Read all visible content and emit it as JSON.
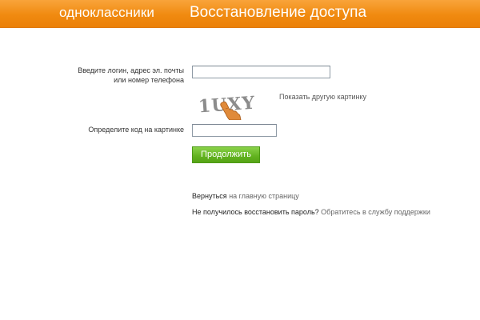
{
  "header": {
    "brand": "одноклассники",
    "title": "Восстановление доступа"
  },
  "form": {
    "login_label_line1": "Введите логин, адрес эл. почты",
    "login_label_line2": "или номер телефона",
    "login_value": "",
    "captcha_text": "1UXY",
    "refresh_captcha_link": "Показать другую картинку",
    "code_label": "Определите код на картинке",
    "code_value": "",
    "continue_button": "Продолжить"
  },
  "footer": {
    "back_prefix": "Вернуться",
    "back_link": "на главную страницу",
    "fail_text": "Не получилось восстановить пароль?",
    "support_link": "Обратитесь в службу поддержки"
  },
  "colors": {
    "header_orange": "#f08a10",
    "button_green": "#62b21f",
    "text_dark": "#333333",
    "link_gray": "#666666"
  }
}
